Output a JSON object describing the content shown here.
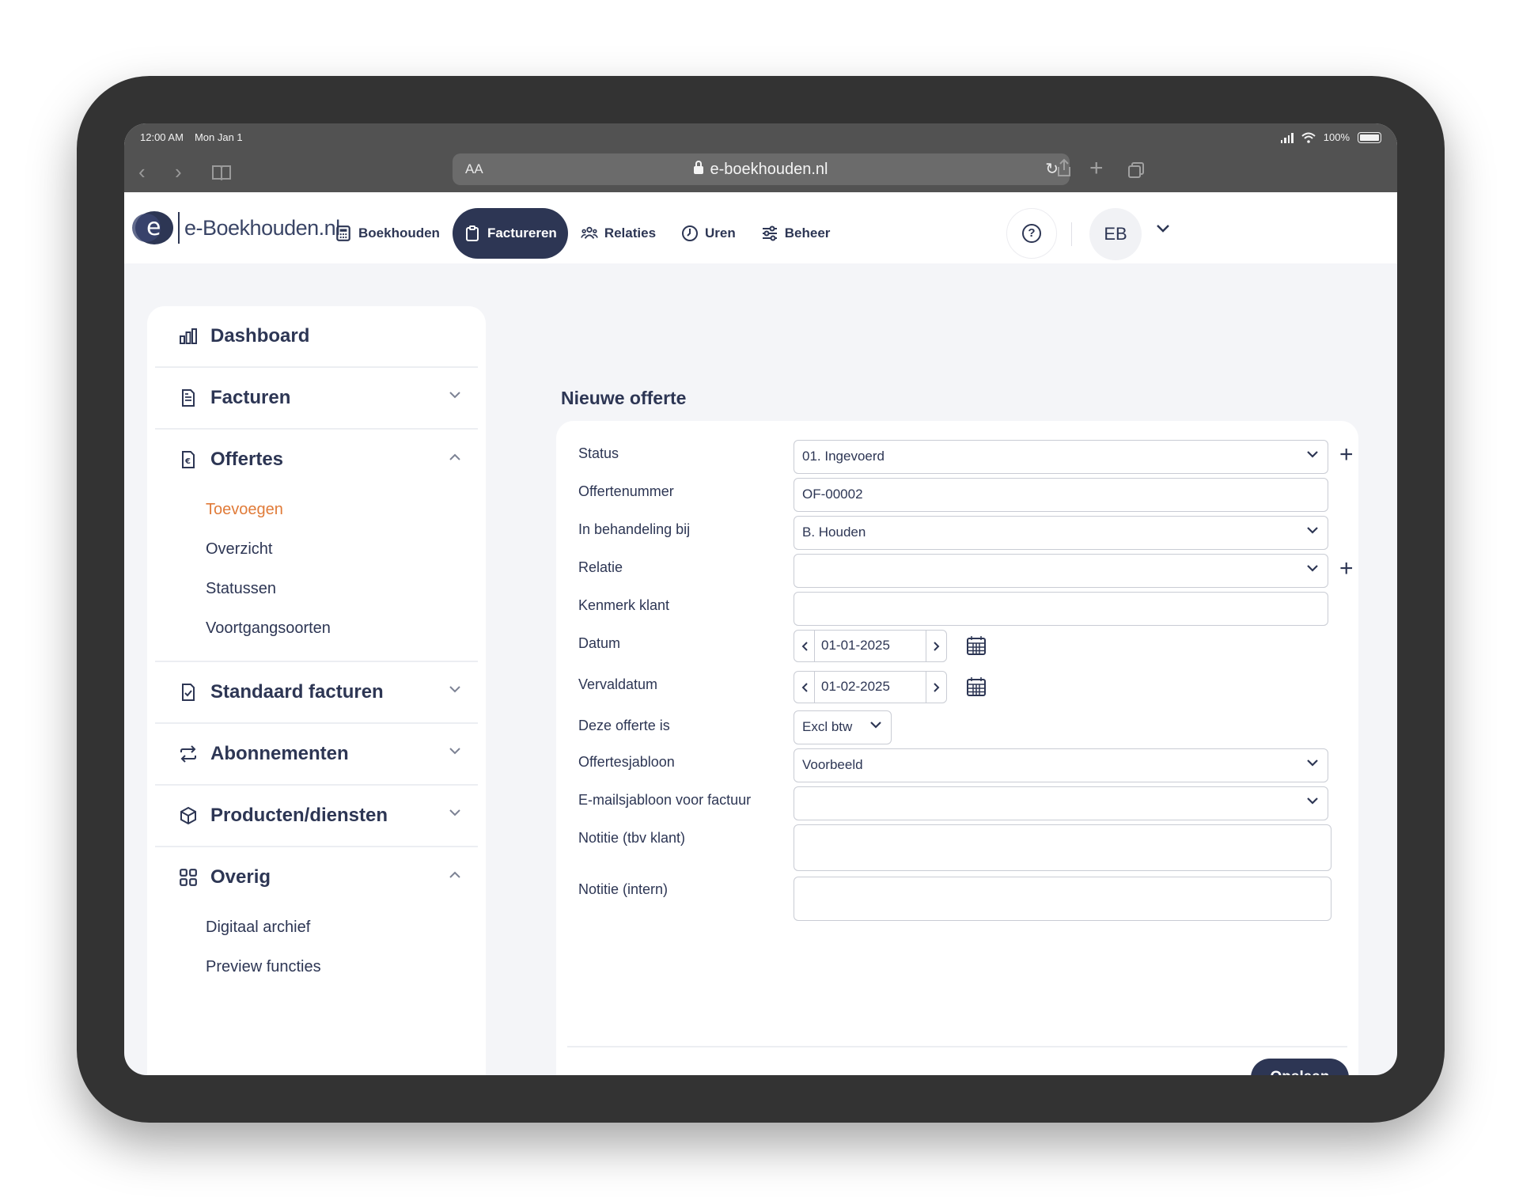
{
  "statusbar": {
    "time": "12:00 AM",
    "date": "Mon Jan 1",
    "battery": "100%"
  },
  "browser": {
    "text_size_label": "AA",
    "url": "e-boekhouden.nl"
  },
  "app": {
    "logo_text": "e-Boekhouden.nl",
    "nav": [
      {
        "label": "Boekhouden",
        "icon": "calculator-icon",
        "active": false
      },
      {
        "label": "Factureren",
        "icon": "clipboard-icon",
        "active": true
      },
      {
        "label": "Relaties",
        "icon": "people-icon",
        "active": false
      },
      {
        "label": "Uren",
        "icon": "clock-icon",
        "active": false
      },
      {
        "label": "Beheer",
        "icon": "sliders-icon",
        "active": false
      }
    ],
    "help_label": "?",
    "avatar_initials": "EB"
  },
  "sidebar": {
    "sections": [
      {
        "label": "Dashboard",
        "icon": "chart-icon",
        "expandable": false
      },
      {
        "label": "Facturen",
        "icon": "document-icon",
        "expandable": true,
        "expanded": false
      },
      {
        "label": "Offertes",
        "icon": "euro-document-icon",
        "expandable": true,
        "expanded": true,
        "items": [
          "Toevoegen",
          "Overzicht",
          "Statussen",
          "Voortgangsoorten"
        ],
        "active_item": "Toevoegen"
      },
      {
        "label": "Standaard facturen",
        "icon": "check-document-icon",
        "expandable": true,
        "expanded": false
      },
      {
        "label": "Abonnementen",
        "icon": "repeat-icon",
        "expandable": true,
        "expanded": false
      },
      {
        "label": "Producten/diensten",
        "icon": "box-icon",
        "expandable": true,
        "expanded": false
      },
      {
        "label": "Overig",
        "icon": "grid-icon",
        "expandable": true,
        "expanded": true,
        "items": [
          "Digitaal archief",
          "Preview functies"
        ]
      }
    ]
  },
  "form": {
    "title": "Nieuwe offerte",
    "status": {
      "label": "Status",
      "value": "01. Ingevoerd"
    },
    "offertenummer": {
      "label": "Offertenummer",
      "value": "OF-00002"
    },
    "behandeling": {
      "label": "In behandeling bij",
      "value": "B. Houden"
    },
    "relatie": {
      "label": "Relatie",
      "value": ""
    },
    "kenmerk": {
      "label": "Kenmerk klant",
      "value": ""
    },
    "datum": {
      "label": "Datum",
      "value": "01-01-2025"
    },
    "vervaldatum": {
      "label": "Vervaldatum",
      "value": "01-02-2025"
    },
    "btw": {
      "label": "Deze offerte is",
      "value": "Excl btw"
    },
    "sjabloon": {
      "label": "Offertesjabloon",
      "value": "Voorbeeld"
    },
    "email_sjabloon": {
      "label": "E-mailsjabloon voor factuur",
      "value": ""
    },
    "notitie_klant": {
      "label": "Notitie (tbv klant)"
    },
    "notitie_intern": {
      "label": "Notitie (intern)"
    },
    "save_label": "Opslaan"
  },
  "colors": {
    "brand": "#2d3654",
    "accent": "#e07b39",
    "background": "#f4f5f8"
  }
}
